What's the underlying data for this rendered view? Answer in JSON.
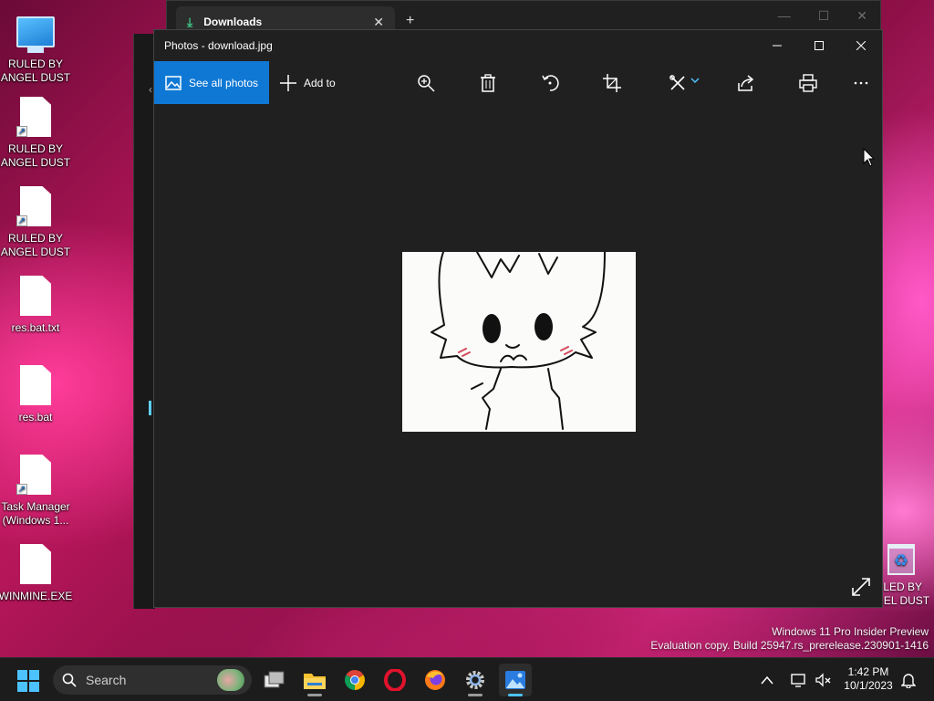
{
  "desktop": {
    "icons": [
      {
        "label": "RULED BY ANGEL DUST",
        "type": "computer-icon"
      },
      {
        "label": "RULED BY ANGEL DUST",
        "type": "file-shortcut-icon"
      },
      {
        "label": "RULED BY ANGEL DUST",
        "type": "file-shortcut-icon"
      },
      {
        "label": "res.bat.txt",
        "type": "file-icon"
      },
      {
        "label": "res.bat",
        "type": "file-icon"
      },
      {
        "label": "Task Manager (Windows 1...",
        "type": "file-shortcut-icon"
      },
      {
        "label": "WINMINE.EXE",
        "type": "file-icon"
      }
    ],
    "recycle_bin_label": "RULED BY ANGEL DUST",
    "watermark": {
      "line1": "Windows 11 Pro Insider Preview",
      "line2": "Evaluation copy. Build 25947.rs_prerelease.230901-1416"
    }
  },
  "downloads_window": {
    "tab_title": "Downloads",
    "tab_close": "✕",
    "new_tab": "+"
  },
  "photos_window": {
    "title": "Photos - download.jpg",
    "toolbar": {
      "see_all_label": "See all photos",
      "add_to_label": "Add to",
      "tools": [
        "zoom-icon",
        "delete-icon",
        "rotate-icon",
        "crop-icon",
        "edit-icon",
        "share-icon",
        "print-icon",
        "more-icon"
      ]
    }
  },
  "taskbar": {
    "search_placeholder": "Search",
    "apps": [
      "task-view-icon",
      "file-explorer-icon",
      "chrome-icon",
      "opera-icon",
      "firefox-icon",
      "settings-icon",
      "photos-icon"
    ],
    "clock": {
      "time": "1:42 PM",
      "date": "10/1/2023"
    }
  },
  "colors": {
    "accent": "#0f78d4",
    "window_bg": "#202020",
    "taskbar_bg": "#1c1c1c"
  }
}
